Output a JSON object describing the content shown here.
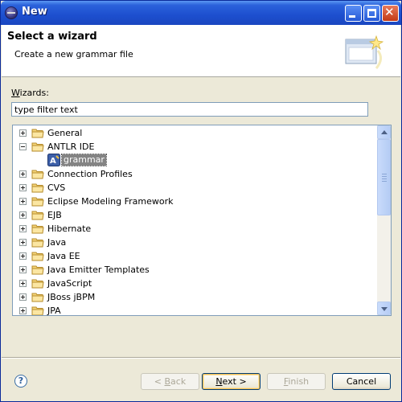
{
  "window": {
    "title": "New"
  },
  "header": {
    "title": "Select a wizard",
    "description": "Create a new grammar file",
    "banner_icon": "new-wizard-banner-icon"
  },
  "wizards": {
    "label_mnemonic": "W",
    "label_rest": "izards:",
    "filter_value": "type filter text"
  },
  "tree": {
    "items": [
      {
        "label": "General",
        "state": "collapsed",
        "depth": 0
      },
      {
        "label": "ANTLR IDE",
        "state": "expanded",
        "depth": 0
      },
      {
        "label": "grammar",
        "state": "leaf",
        "depth": 1,
        "selected": true
      },
      {
        "label": "Connection Profiles",
        "state": "collapsed",
        "depth": 0
      },
      {
        "label": "CVS",
        "state": "collapsed",
        "depth": 0
      },
      {
        "label": "Eclipse Modeling Framework",
        "state": "collapsed",
        "depth": 0
      },
      {
        "label": "EJB",
        "state": "collapsed",
        "depth": 0
      },
      {
        "label": "Hibernate",
        "state": "collapsed",
        "depth": 0
      },
      {
        "label": "Java",
        "state": "collapsed",
        "depth": 0
      },
      {
        "label": "Java EE",
        "state": "collapsed",
        "depth": 0
      },
      {
        "label": "Java Emitter Templates",
        "state": "collapsed",
        "depth": 0
      },
      {
        "label": "JavaScript",
        "state": "collapsed",
        "depth": 0
      },
      {
        "label": "JBoss jBPM",
        "state": "collapsed",
        "depth": 0
      },
      {
        "label": "JPA",
        "state": "collapsed",
        "depth": 0
      }
    ]
  },
  "buttons": {
    "back": {
      "mnemonic": "B",
      "label": "ack",
      "prefix": "< ",
      "enabled": false
    },
    "next": {
      "mnemonic": "N",
      "label": "ext >",
      "enabled": true
    },
    "finish": {
      "mnemonic": "F",
      "label": "inish",
      "enabled": false
    },
    "cancel": {
      "label": "Cancel",
      "enabled": true
    }
  },
  "help": {
    "glyph": "?"
  }
}
